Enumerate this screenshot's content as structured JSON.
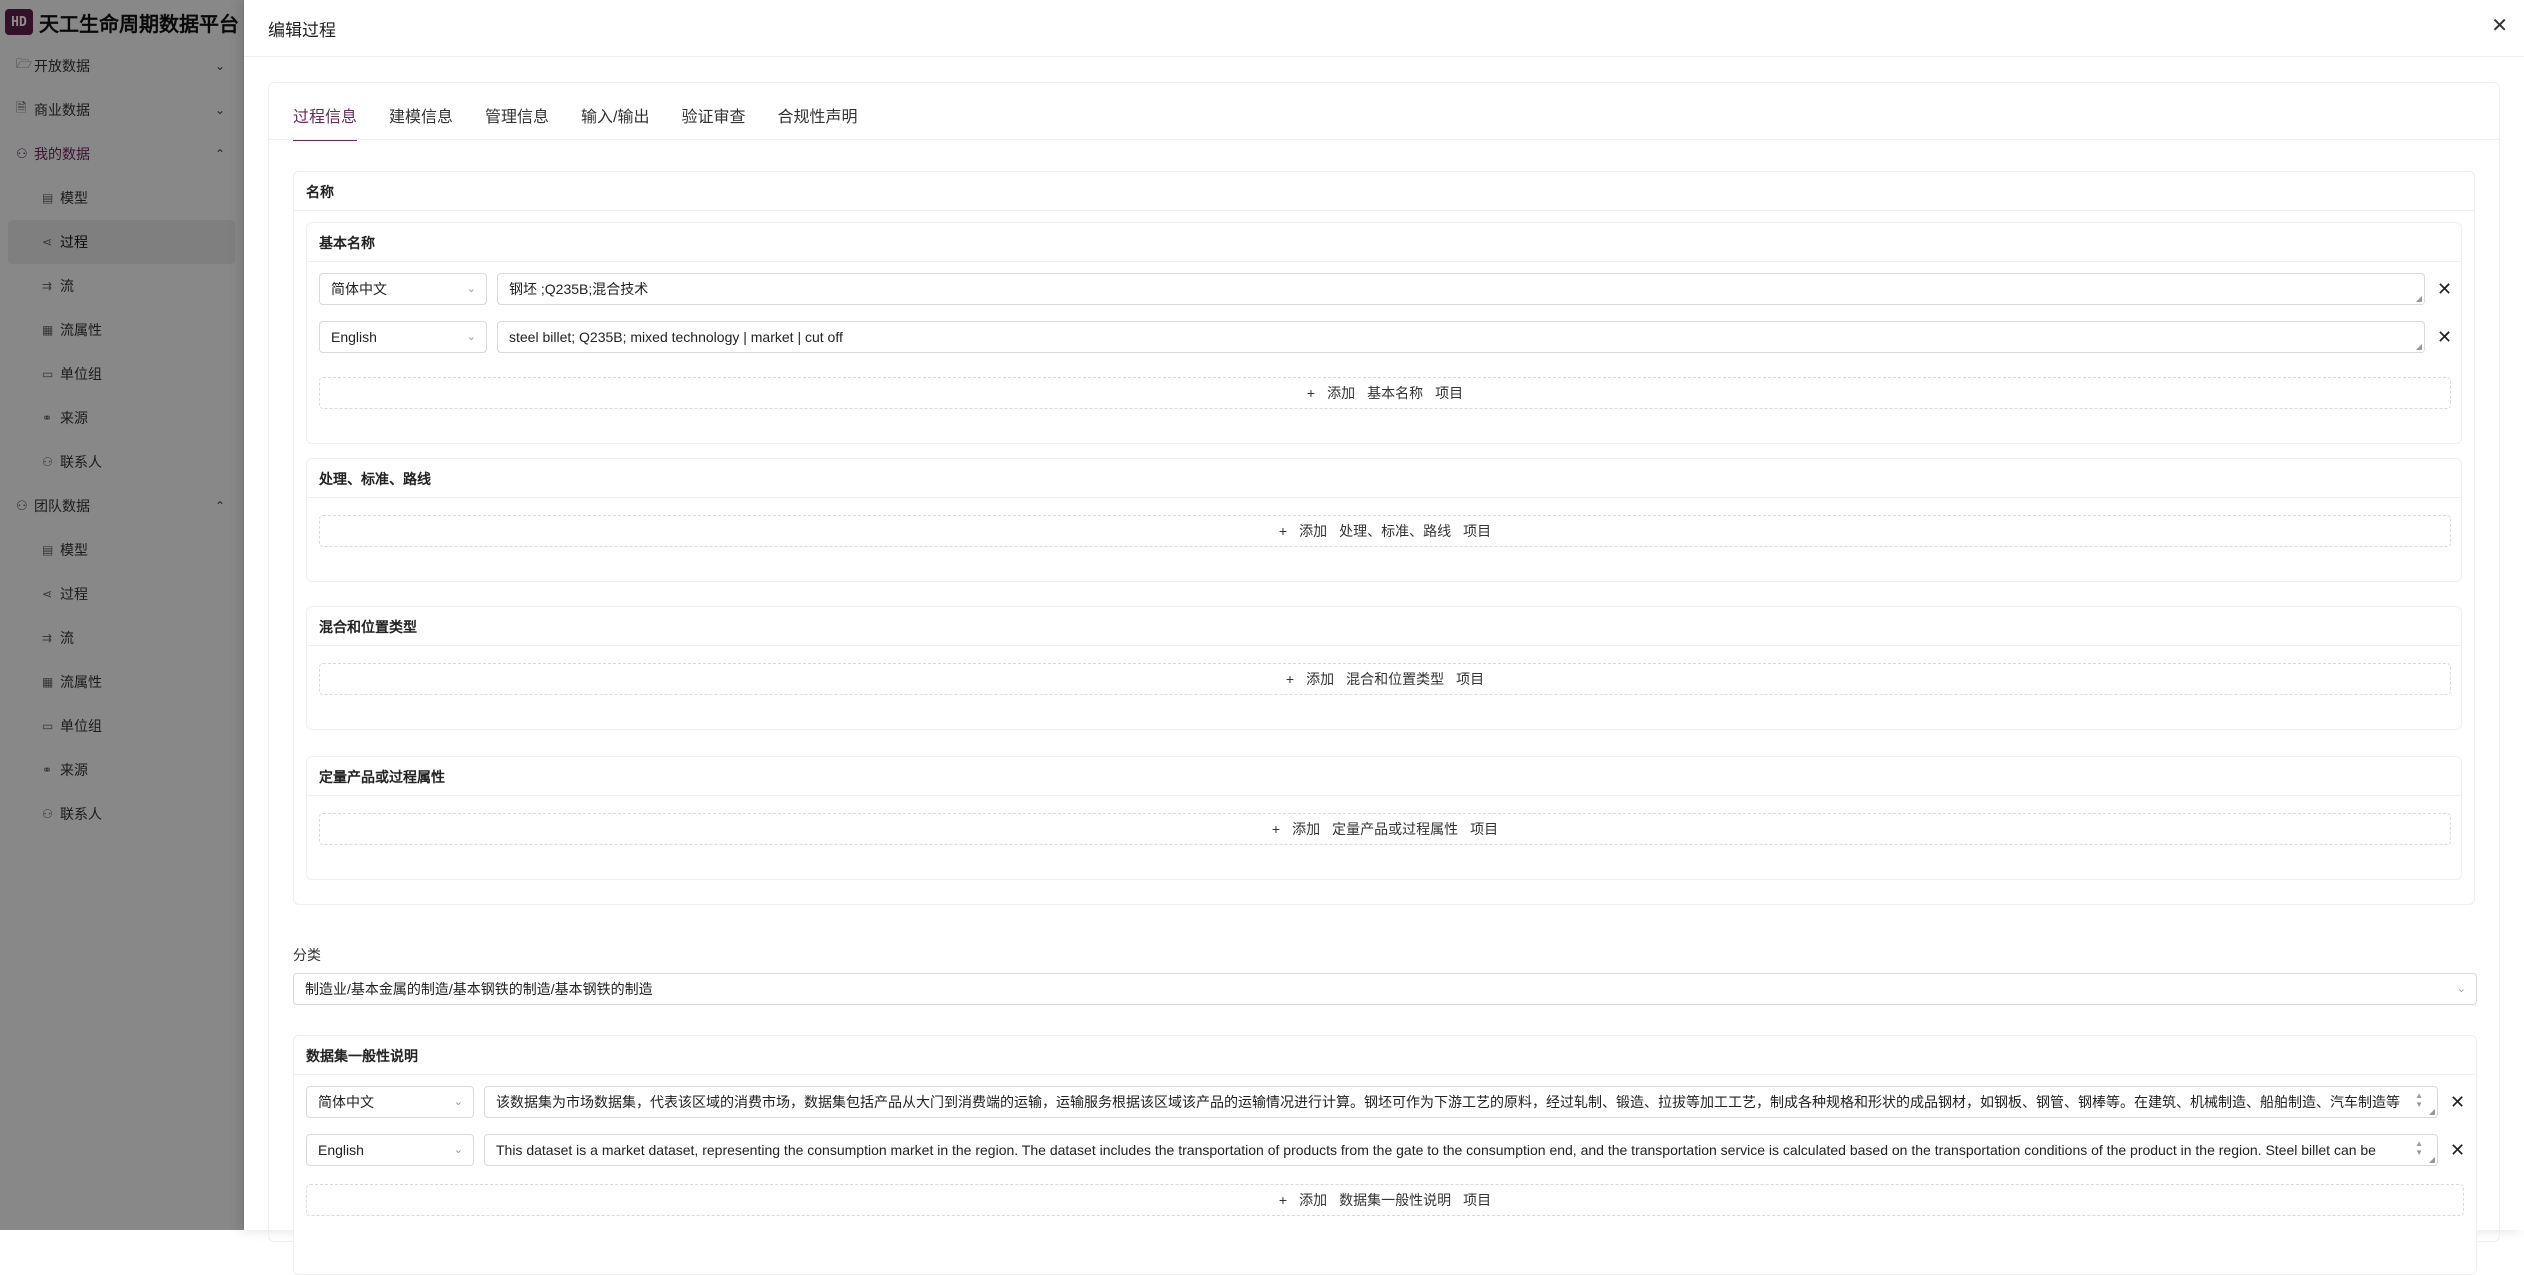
{
  "brand": {
    "logo": "HD",
    "title": "天工生命周期数据平台"
  },
  "sidebar": {
    "groups": [
      {
        "label": "开放数据",
        "icon": "folder-open-icon",
        "expanded": false
      },
      {
        "label": "商业数据",
        "icon": "file-icon",
        "expanded": false
      },
      {
        "label": "我的数据",
        "icon": "user-icon",
        "expanded": true,
        "items": [
          "模型",
          "过程",
          "流",
          "流属性",
          "单位组",
          "来源",
          "联系人"
        ],
        "selected": "过程"
      },
      {
        "label": "团队数据",
        "icon": "team-icon",
        "expanded": true,
        "items": [
          "模型",
          "过程",
          "流",
          "流属性",
          "单位组",
          "来源",
          "联系人"
        ]
      }
    ]
  },
  "drawer": {
    "title": "编辑过程",
    "close_icon": "close-icon"
  },
  "tabs": [
    "过程信息",
    "建模信息",
    "管理信息",
    "输入/输出",
    "验证审查",
    "合规性声明"
  ],
  "active_tab": "过程信息",
  "name_section": {
    "title": "名称",
    "basic_name": {
      "title": "基本名称",
      "rows": [
        {
          "lang": "简体中文",
          "value": "钢坯 ;Q235B;混合技术"
        },
        {
          "lang": "English",
          "value": "steel billet; Q235B; mixed technology | market | cut off"
        }
      ],
      "add": {
        "plus": "+",
        "verb": "添加",
        "target": "基本名称",
        "suffix": "项目"
      }
    },
    "treatment": {
      "title": "处理、标准、路线",
      "add": {
        "plus": "+",
        "verb": "添加",
        "target": "处理、标准、路线",
        "suffix": "项目"
      }
    },
    "mix_location": {
      "title": "混合和位置类型",
      "add": {
        "plus": "+",
        "verb": "添加",
        "target": "混合和位置类型",
        "suffix": "项目"
      }
    },
    "quant_props": {
      "title": "定量产品或过程属性",
      "add": {
        "plus": "+",
        "verb": "添加",
        "target": "定量产品或过程属性",
        "suffix": "项目"
      }
    }
  },
  "classification": {
    "label": "分类",
    "value": "制造业/基本金属的制造/基本钢铁的制造/基本钢铁的制造"
  },
  "general_comment": {
    "title": "数据集一般性说明",
    "rows": [
      {
        "lang": "简体中文",
        "value": "该数据集为市场数据集，代表该区域的消费市场，数据集包括产品从大门到消费端的运输，运输服务根据该区域该产品的运输情况进行计算。钢坯可作为下游工艺的原料，经过轧制、锻造、拉拔等加工工艺，制成各种规格和形状的成品钢材，如钢板、钢管、钢棒等。在建筑、机械制造、船舶制造、汽车制造等"
      },
      {
        "lang": "English",
        "value": "This dataset is a market dataset, representing the consumption market in the region. The dataset includes the transportation of products from the gate to the consumption end, and the transportation service is calculated based on the transportation conditions of the product in the region. Steel billet can be"
      }
    ],
    "add": {
      "plus": "+",
      "verb": "添加",
      "target": "数据集一般性说明",
      "suffix": "项目"
    }
  }
}
